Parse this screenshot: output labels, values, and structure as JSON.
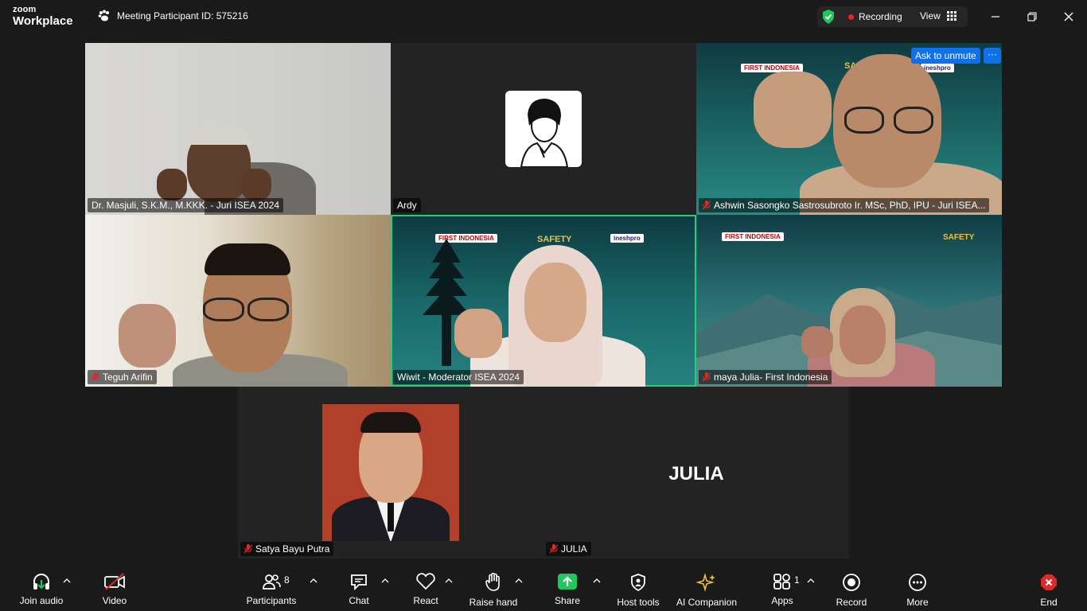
{
  "app": {
    "logo_line1": "zoom",
    "logo_line2": "Workplace",
    "meeting_id": "Meeting Participant ID: 575216",
    "recording": "Recording",
    "view": "View"
  },
  "participants_tiles": [
    {
      "name": "Dr. Masjuli, S.K.M., M.KKK. - Juri ISEA 2024"
    },
    {
      "name": "Ardy"
    },
    {
      "name": "Ashwin Sasongko Sastrosubroto Ir. MSc, PhD, IPU - Juri ISEA..."
    },
    {
      "name": "Teguh Arifin"
    },
    {
      "name": "Wiwit - Moderator ISEA 2024"
    },
    {
      "name": "maya Julia- First Indonesia"
    },
    {
      "name": "Satya Bayu Putra"
    },
    {
      "name": "JULIA",
      "avatar_text": "JULIA"
    }
  ],
  "overlay": {
    "ask_to_unmute": "Ask to unmute",
    "more": "···"
  },
  "banners": {
    "first_indonesia": "FIRST INDONESIA",
    "safety": "SAFETY",
    "ineshpro": "ineshpro"
  },
  "toolbar": {
    "join_audio": "Join audio",
    "video": "Video",
    "participants": "Participants",
    "participants_count": "8",
    "chat": "Chat",
    "react": "React",
    "raise_hand": "Raise hand",
    "share": "Share",
    "host_tools": "Host tools",
    "ai_companion": "AI Companion",
    "apps": "Apps",
    "apps_count": "1",
    "record": "Record",
    "more": "More",
    "end": "End"
  },
  "colors": {
    "accent_blue": "#0e71eb",
    "active_speaker": "#22d07a",
    "share_green": "#22c55e",
    "end_red": "#e02828",
    "recording_red": "#e02828"
  }
}
